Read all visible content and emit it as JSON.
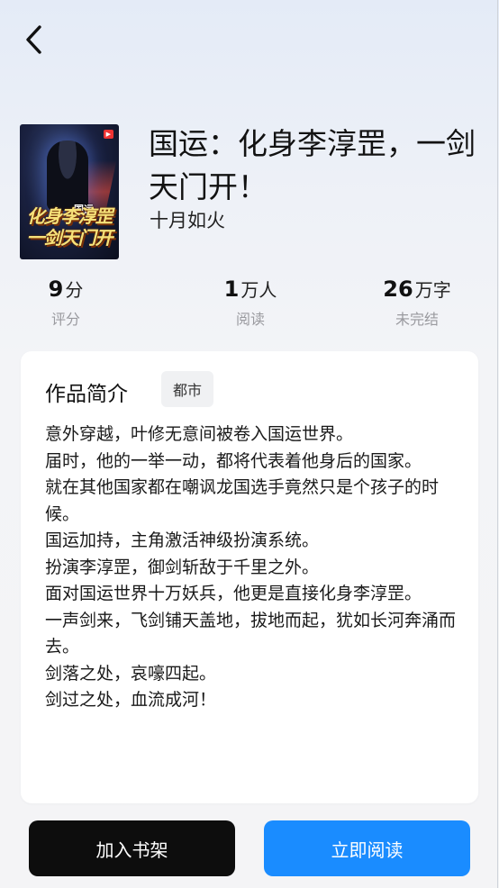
{
  "nav": {
    "back_icon": "chevron-left-icon"
  },
  "book": {
    "title": "国运：化身李淳罡，一剑天门开！",
    "author": "十月如火",
    "cover": {
      "top_text": "国运",
      "line1": "化身李淳罡",
      "line2": "一剑天门开"
    }
  },
  "stats": {
    "rating": {
      "value": "9",
      "unit": "分",
      "label": "评分"
    },
    "readers": {
      "value": "1",
      "unit": "万人",
      "label": "阅读"
    },
    "words": {
      "value": "26",
      "unit": "万字",
      "label": "未完结"
    }
  },
  "intro": {
    "heading": "作品简介",
    "tag": "都市",
    "lines": [
      "意外穿越，叶修无意间被卷入国运世界。",
      "届时，他的一举一动，都将代表着他身后的国家。",
      "就在其他国家都在嘲讽龙国选手竟然只是个孩子的时候。",
      "国运加持，主角激活神级扮演系统。",
      "扮演李淳罡，御剑斩敌于千里之外。",
      "面对国运世界十万妖兵，他更是直接化身李淳罡。",
      "一声剑来，飞剑铺天盖地，拔地而起，犹如长河奔涌而去。",
      "剑落之处，哀嚎四起。",
      "剑过之处，血流成河！"
    ]
  },
  "actions": {
    "add_shelf": "加入书架",
    "read_now": "立即阅读"
  },
  "colors": {
    "primary": "#1a8cff",
    "dark_button": "#0d0d0d",
    "muted": "#9a9a9f"
  }
}
